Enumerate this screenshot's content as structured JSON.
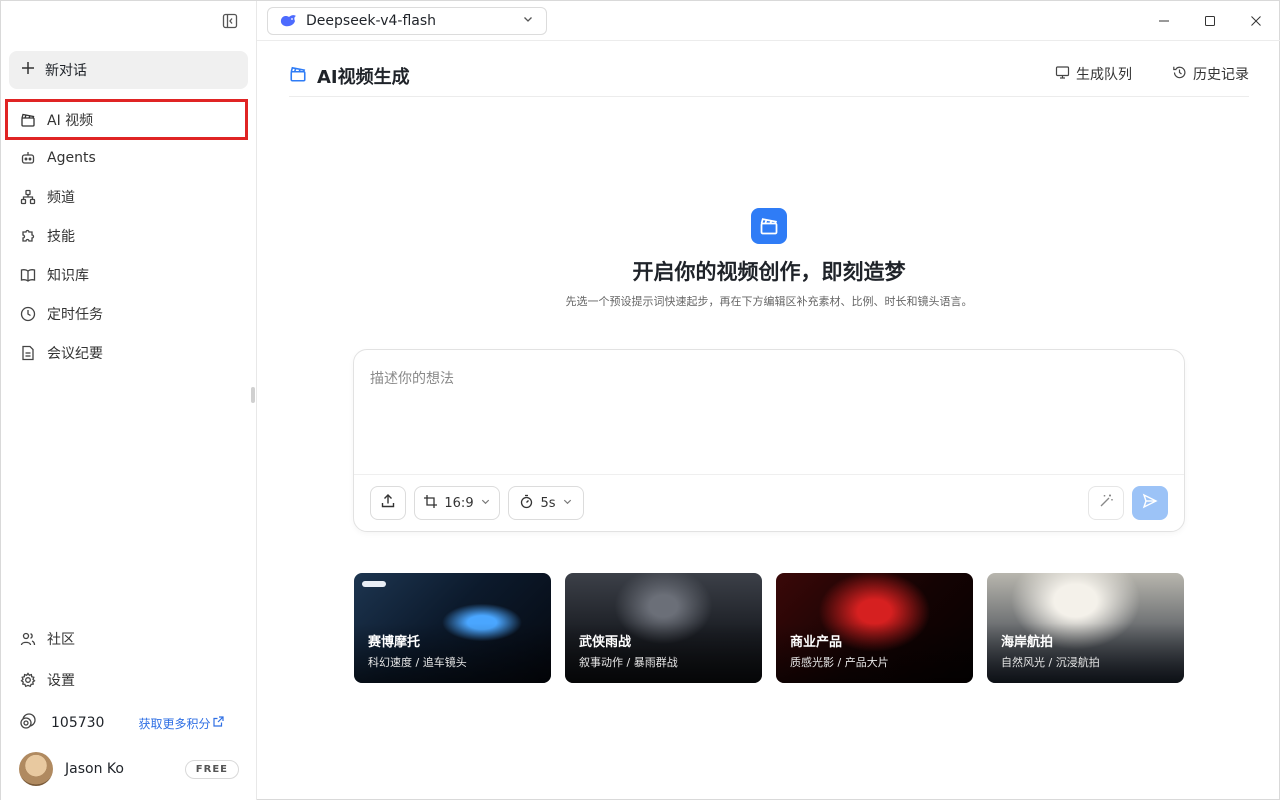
{
  "sidebar": {
    "new_chat_label": "新对话",
    "items": [
      {
        "label": "AI 视频",
        "icon": "clapperboard-icon"
      },
      {
        "label": "Agents",
        "icon": "bot-icon"
      },
      {
        "label": "频道",
        "icon": "network-icon"
      },
      {
        "label": "技能",
        "icon": "puzzle-icon"
      },
      {
        "label": "知识库",
        "icon": "book-icon"
      },
      {
        "label": "定时任务",
        "icon": "clock-icon"
      },
      {
        "label": "会议纪要",
        "icon": "document-icon"
      }
    ],
    "bottom_items": [
      {
        "label": "社区",
        "icon": "users-icon"
      },
      {
        "label": "设置",
        "icon": "gear-icon"
      }
    ],
    "points": "105730",
    "get_more_points": "获取更多积分",
    "user_name": "Jason Ko",
    "plan_badge": "FREE"
  },
  "topbar": {
    "model_name": "Deepseek-v4-flash"
  },
  "header": {
    "title": "AI视频生成",
    "queue_label": "生成队列",
    "history_label": "历史记录"
  },
  "hero": {
    "title": "开启你的视频创作，即刻造梦",
    "subtitle": "先选一个预设提示词快速起步，再在下方编辑区补充素材、比例、时长和镜头语言。"
  },
  "prompt": {
    "placeholder": "描述你的想法",
    "ratio": "16:9",
    "duration": "5s"
  },
  "templates": [
    {
      "title": "赛博摩托",
      "subtitle": "科幻速度 / 追车镜头"
    },
    {
      "title": "武侠雨战",
      "subtitle": "叙事动作 / 暴雨群战"
    },
    {
      "title": "商业产品",
      "subtitle": "质感光影 / 产品大片"
    },
    {
      "title": "海岸航拍",
      "subtitle": "自然风光 / 沉浸航拍"
    }
  ],
  "colors": {
    "accent": "#2f7cf6",
    "highlight_border": "#e02424",
    "send_disabled": "#9cc3f7"
  }
}
